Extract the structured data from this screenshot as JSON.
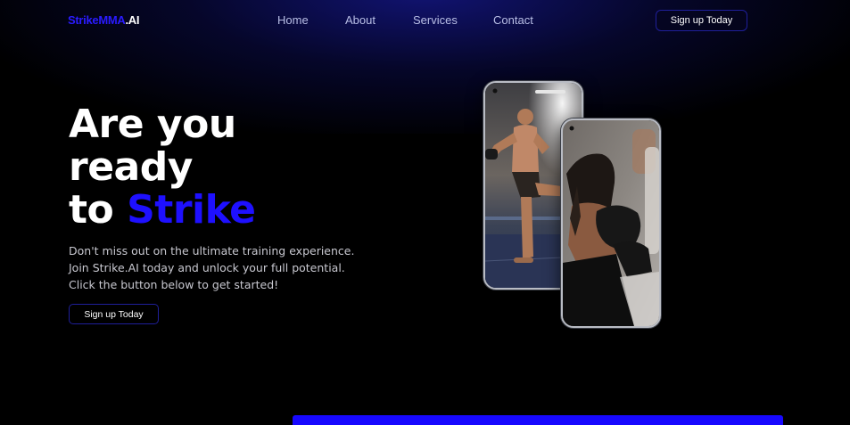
{
  "nav": {
    "logo_brand": "StrikeMMA",
    "logo_suffix": ".AI",
    "links": [
      "Home",
      "About",
      "Services",
      "Contact"
    ],
    "cta": "Sign up Today"
  },
  "hero": {
    "title_line1": "Are you",
    "title_line2": "ready",
    "title_line3_prefix": "to",
    "title_accent": "Strike",
    "description": [
      "Don't miss out on the ultimate training experience.",
      "Join Strike.AI today and unlock your full potential.",
      "Click the button below to get started!"
    ],
    "cta": "Sign up Today"
  },
  "colors": {
    "accent": "#1e10ff",
    "background": "#000000",
    "nav_text": "#b9bfe6"
  },
  "images": {
    "phone_left": "mma-fighter-kick-photo",
    "phone_right": "boxer-woman-gloves-photo"
  }
}
